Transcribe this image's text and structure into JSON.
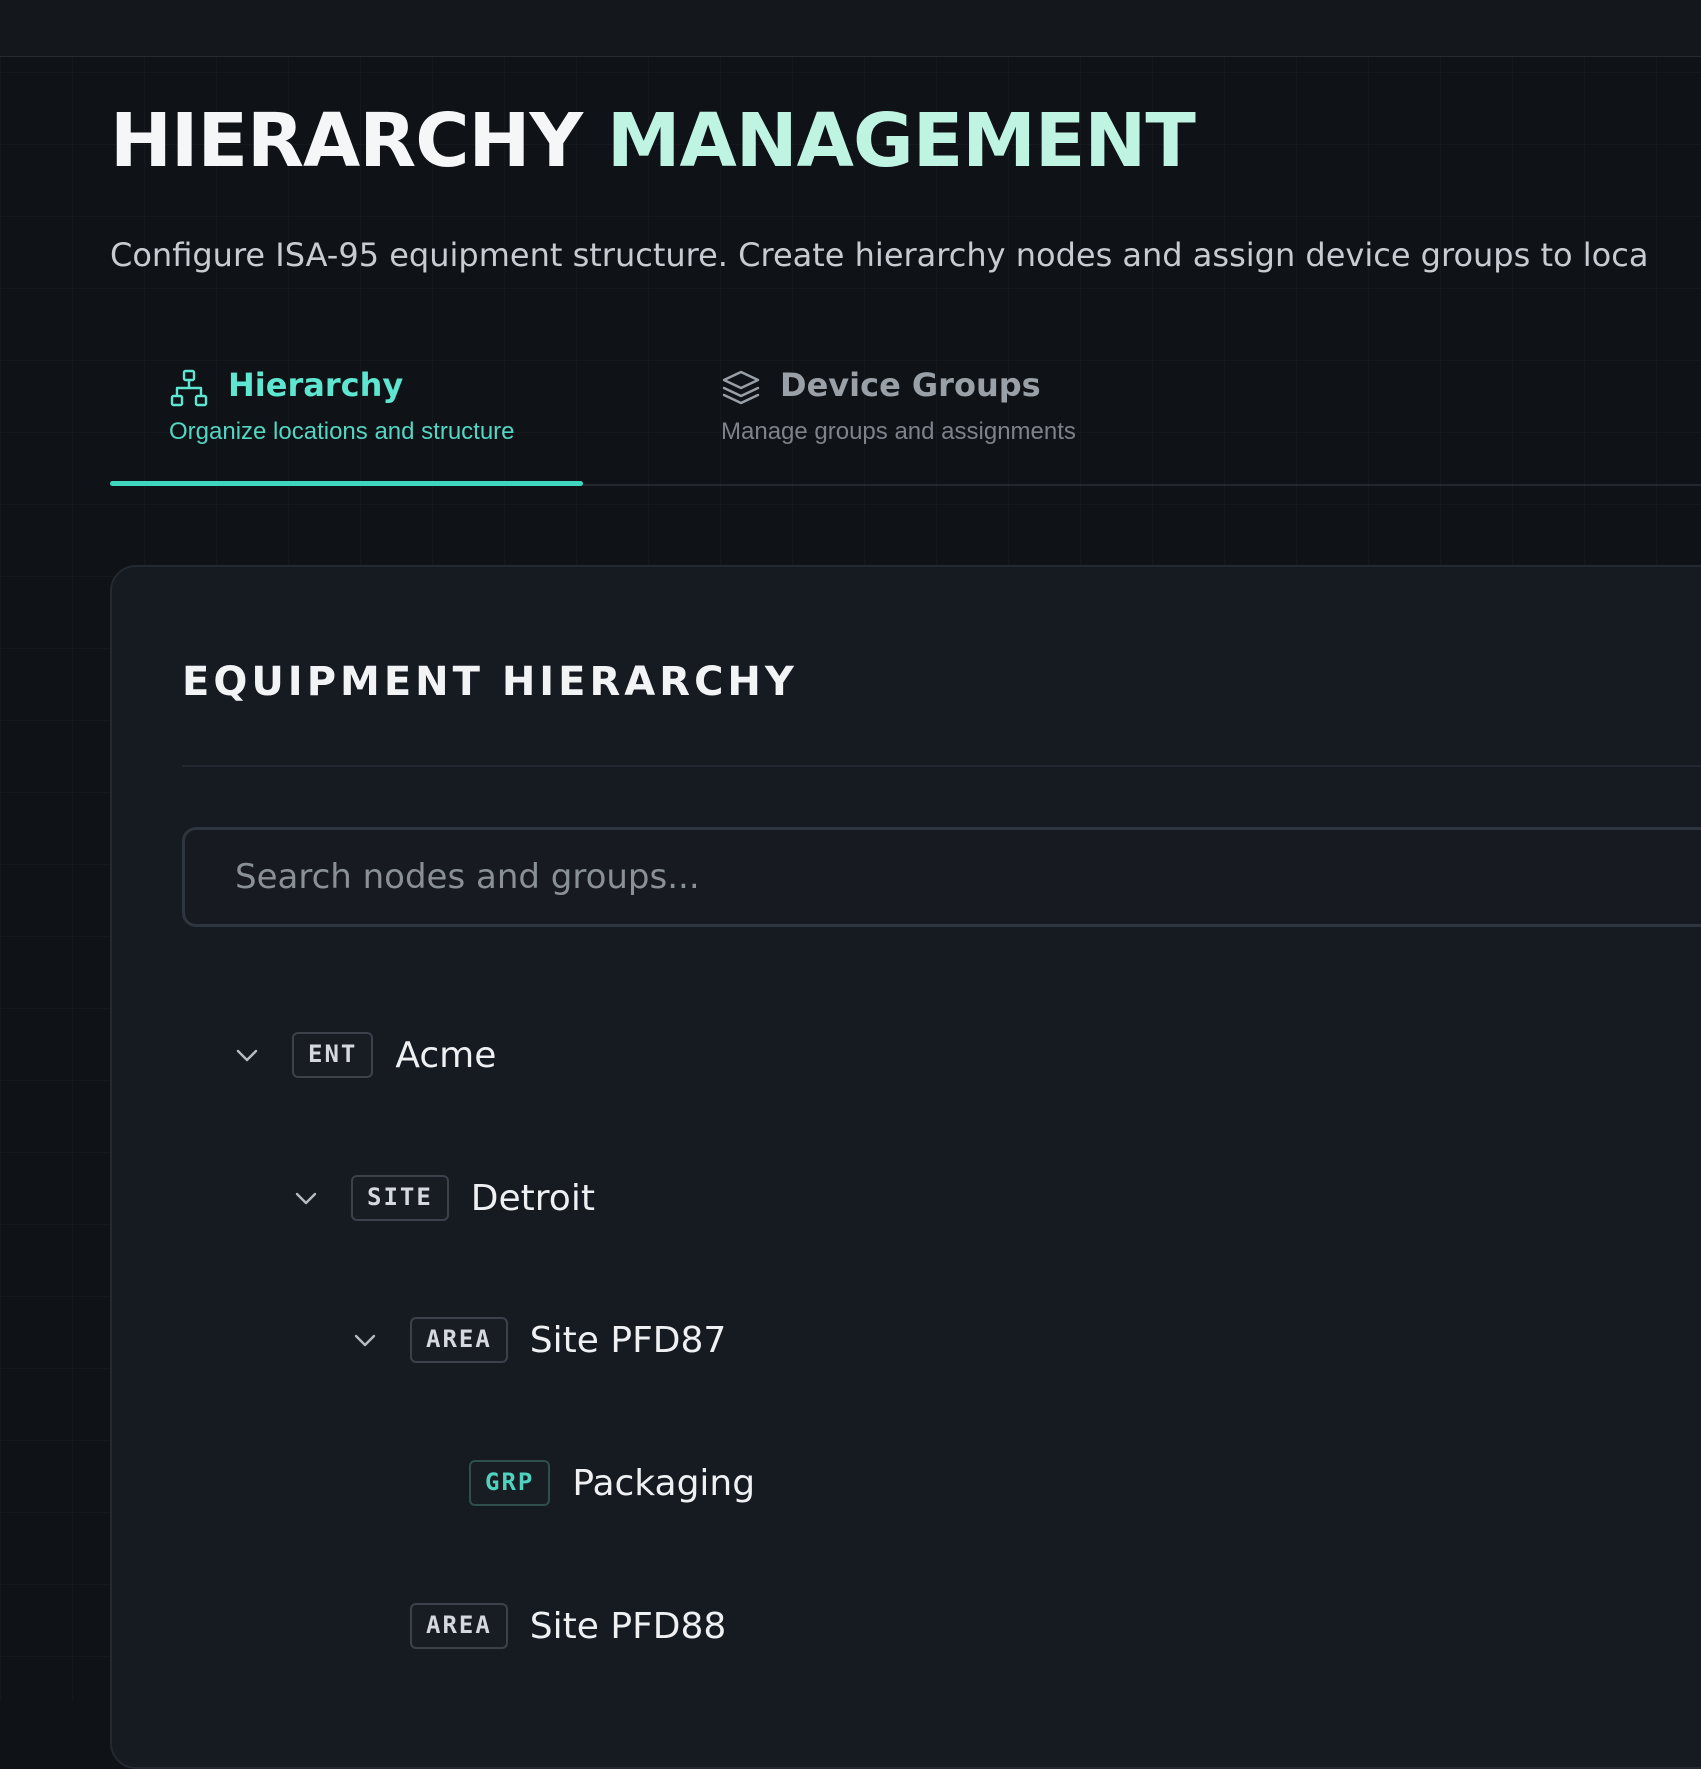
{
  "header": {
    "title_part1": "HIERARCHY",
    "title_part2": "MANAGEMENT",
    "subtitle": "Configure ISA-95 equipment structure. Create hierarchy nodes and assign device groups to loca"
  },
  "tabs": [
    {
      "label": "Hierarchy",
      "subtitle": "Organize locations and structure",
      "icon": "hierarchy-icon",
      "active": true
    },
    {
      "label": "Device Groups",
      "subtitle": "Manage groups and assignments",
      "icon": "layers-icon",
      "active": false
    }
  ],
  "panel": {
    "title": "EQUIPMENT HIERARCHY",
    "search_placeholder": "Search nodes and groups..."
  },
  "tree": [
    {
      "type": "ENT",
      "name": "Acme",
      "expanded": true,
      "level": 0
    },
    {
      "type": "SITE",
      "name": "Detroit",
      "expanded": true,
      "level": 1
    },
    {
      "type": "AREA",
      "name": "Site PFD87",
      "expanded": true,
      "level": 2
    },
    {
      "type": "GRP",
      "name": "Packaging",
      "expanded": false,
      "level": 3
    },
    {
      "type": "AREA",
      "name": "Site PFD88",
      "expanded": false,
      "level": 2
    }
  ],
  "colors": {
    "accent": "#3fd6c0",
    "background": "#0f1217",
    "card": "#161a21"
  }
}
